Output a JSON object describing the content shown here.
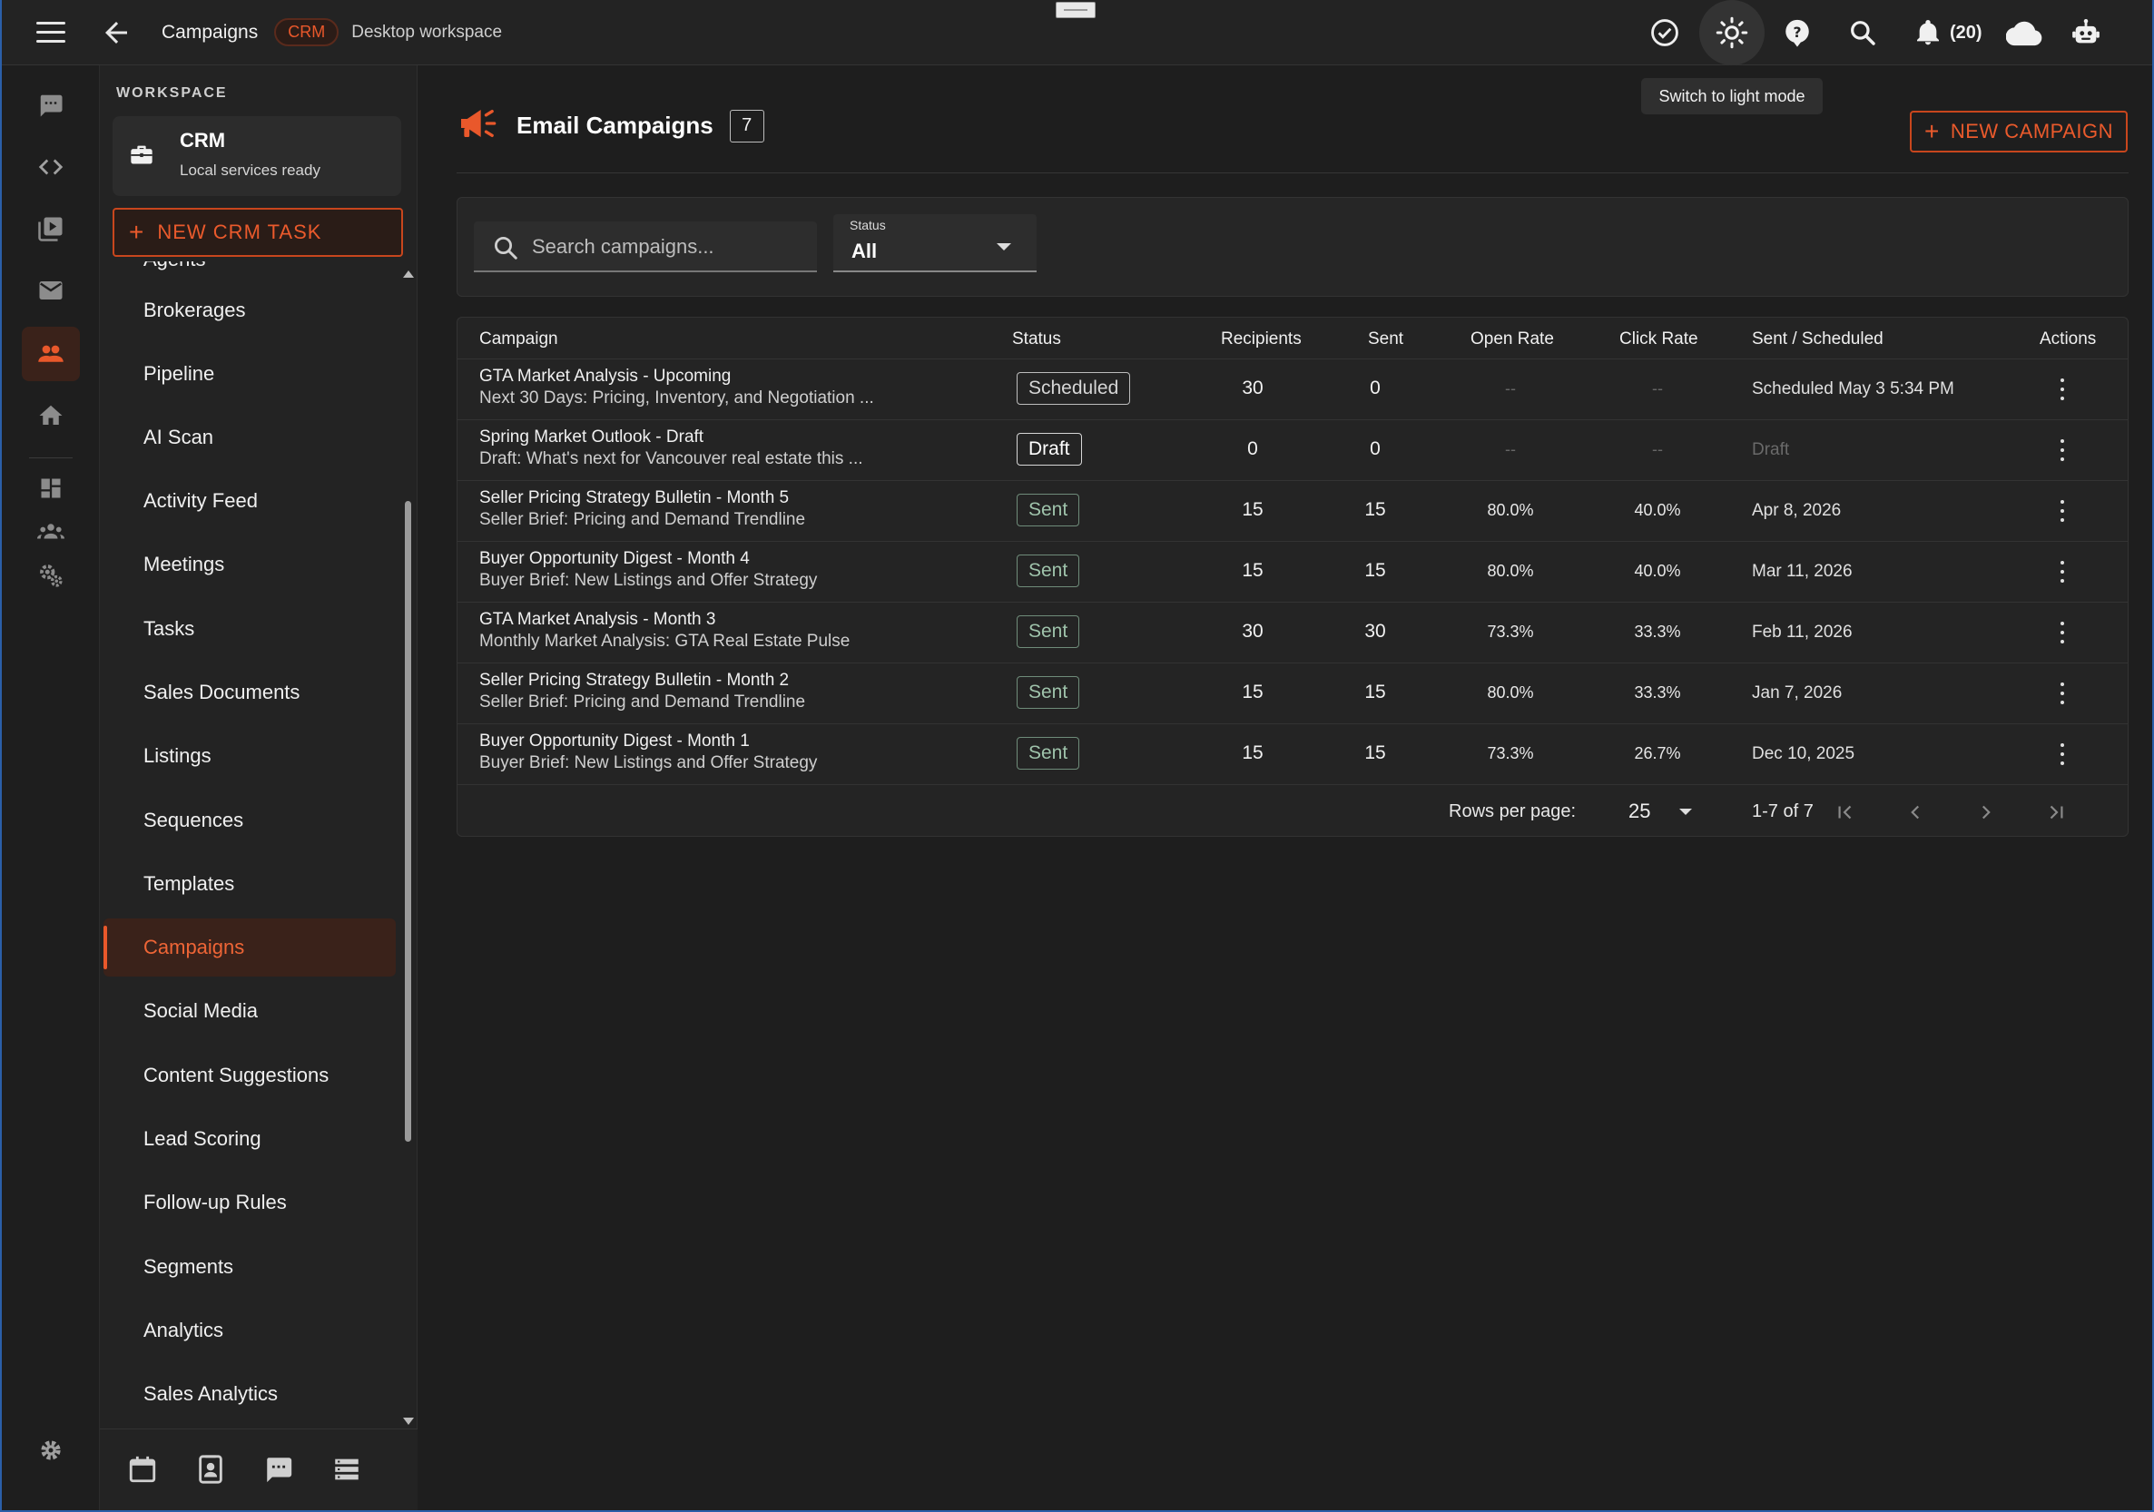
{
  "header": {
    "title": "Campaigns",
    "chip": "CRM",
    "subtitle": "Desktop workspace",
    "notifications_count": "(20)",
    "tooltip": "Switch to light mode"
  },
  "workspace": {
    "label": "WORKSPACE",
    "name": "CRM",
    "status": "Local services ready",
    "new_task_label": "NEW CRM TASK"
  },
  "nav": {
    "items": [
      {
        "label": "Agents"
      },
      {
        "label": "Brokerages"
      },
      {
        "label": "Pipeline"
      },
      {
        "label": "AI Scan"
      },
      {
        "label": "Activity Feed"
      },
      {
        "label": "Meetings"
      },
      {
        "label": "Tasks"
      },
      {
        "label": "Sales Documents"
      },
      {
        "label": "Listings"
      },
      {
        "label": "Sequences"
      },
      {
        "label": "Templates"
      },
      {
        "label": "Campaigns",
        "active": true
      },
      {
        "label": "Social Media"
      },
      {
        "label": "Content Suggestions"
      },
      {
        "label": "Lead Scoring"
      },
      {
        "label": "Follow-up Rules"
      },
      {
        "label": "Segments"
      },
      {
        "label": "Analytics"
      },
      {
        "label": "Sales Analytics"
      }
    ]
  },
  "main": {
    "title": "Email Campaigns",
    "count": "7",
    "new_campaign_label": "NEW CAMPAIGN",
    "search_placeholder": "Search campaigns...",
    "status_filter": {
      "label": "Status",
      "value": "All"
    }
  },
  "table": {
    "columns": [
      "Campaign",
      "Status",
      "Recipients",
      "Sent",
      "Open Rate",
      "Click Rate",
      "Sent / Scheduled",
      "Actions"
    ],
    "rows": [
      {
        "name": "GTA Market Analysis - Upcoming",
        "subject": "Next 30 Days: Pricing, Inventory, and Negotiation ...",
        "status": "Scheduled",
        "recipients": "30",
        "sent": "0",
        "open_rate": "--",
        "click_rate": "--",
        "when": "Scheduled May 3 5:34 PM"
      },
      {
        "name": "Spring Market Outlook - Draft",
        "subject": "Draft: What's next for Vancouver real estate this ...",
        "status": "Draft",
        "recipients": "0",
        "sent": "0",
        "open_rate": "--",
        "click_rate": "--",
        "when": "Draft"
      },
      {
        "name": "Seller Pricing Strategy Bulletin - Month 5",
        "subject": "Seller Brief: Pricing and Demand Trendline",
        "status": "Sent",
        "recipients": "15",
        "sent": "15",
        "open_rate": "80.0%",
        "click_rate": "40.0%",
        "when": "Apr 8, 2026"
      },
      {
        "name": "Buyer Opportunity Digest - Month 4",
        "subject": "Buyer Brief: New Listings and Offer Strategy",
        "status": "Sent",
        "recipients": "15",
        "sent": "15",
        "open_rate": "80.0%",
        "click_rate": "40.0%",
        "when": "Mar 11, 2026"
      },
      {
        "name": "GTA Market Analysis - Month 3",
        "subject": "Monthly Market Analysis: GTA Real Estate Pulse",
        "status": "Sent",
        "recipients": "30",
        "sent": "30",
        "open_rate": "73.3%",
        "click_rate": "33.3%",
        "when": "Feb 11, 2026"
      },
      {
        "name": "Seller Pricing Strategy Bulletin - Month 2",
        "subject": "Seller Brief: Pricing and Demand Trendline",
        "status": "Sent",
        "recipients": "15",
        "sent": "15",
        "open_rate": "80.0%",
        "click_rate": "33.3%",
        "when": "Jan 7, 2026"
      },
      {
        "name": "Buyer Opportunity Digest - Month 1",
        "subject": "Buyer Brief: New Listings and Offer Strategy",
        "status": "Sent",
        "recipients": "15",
        "sent": "15",
        "open_rate": "73.3%",
        "click_rate": "26.7%",
        "when": "Dec 10, 2025"
      }
    ]
  },
  "pagination": {
    "rows_per_page_label": "Rows per page:",
    "rows_per_page": "25",
    "range": "1-7 of 7"
  },
  "colors": {
    "accent": "#e9582b",
    "background": "#1e1e1e",
    "panel": "#242424",
    "sent_chip": "#9fc3ab"
  },
  "icons": {
    "rail": [
      "chat-icon",
      "code-icon",
      "video-library-icon",
      "mail-icon",
      "people-icon",
      "home-icon",
      "dashboard-icon",
      "groups-icon",
      "settings-gears-icon",
      "settings-icon"
    ],
    "topbar": [
      "task-check-icon",
      "light-mode-icon",
      "help-icon",
      "search-icon",
      "bell-icon",
      "cloud-icon",
      "robot-icon"
    ],
    "bottom": [
      "calendar-icon",
      "contact-icon",
      "message-icon",
      "list-icon"
    ]
  }
}
